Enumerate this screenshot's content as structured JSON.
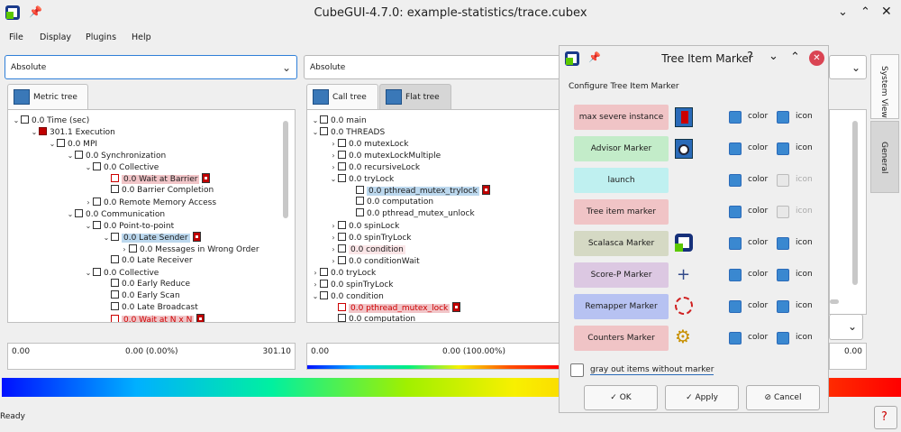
{
  "window": {
    "title": "CubeGUI-4.7.0: example-statistics/trace.cubex"
  },
  "menu": [
    "File",
    "Display",
    "Plugins",
    "Help"
  ],
  "metric": {
    "combo": "Absolute",
    "tab": "Metric tree",
    "scale_left": "0.00",
    "scale_mid": "0.00 (0.00%)",
    "scale_right": "301.10",
    "nodes": [
      "0.0 Time (sec)",
      "301.1 Execution",
      "0.0 MPI",
      "0.0 Synchronization",
      "0.0 Collective",
      "0.0 Wait at Barrier",
      "0.0 Barrier Completion",
      "0.0 Remote Memory Access",
      "0.0 Communication",
      "0.0 Point-to-point",
      "0.0 Late Sender",
      "0.0 Messages in Wrong Order",
      "0.0 Late Receiver",
      "0.0 Collective",
      "0.0 Early Reduce",
      "0.0 Early Scan",
      "0.0 Late Broadcast",
      "0.0 Wait at N x N"
    ]
  },
  "call": {
    "combo": "Absolute",
    "tab_call": "Call tree",
    "tab_flat": "Flat tree",
    "scale_left": "0.00",
    "scale_mid": "0.00 (100.00%)",
    "nodes": [
      "0.0 main",
      "0.0 THREADS",
      "0.0 mutexLock",
      "0.0 mutexLockMultiple",
      "0.0 recursiveLock",
      "0.0 tryLock",
      "0.0 pthread_mutex_trylock",
      "0.0 computation",
      "0.0 pthread_mutex_unlock",
      "0.0 spinLock",
      "0.0 spinTryLock",
      "0.0 condition",
      "0.0 conditionWait",
      "0.0 tryLock",
      "0.0 spinTryLock",
      "0.0 condition",
      "0.0 pthread_mutex_lock",
      "0.0 computation"
    ]
  },
  "system": {
    "scale_right": "0.00",
    "tab_system": "System View",
    "tab_general": "General"
  },
  "dialog": {
    "title": "Tree Item Marker",
    "heading": "Configure Tree Item Marker",
    "color_label": "color",
    "icon_label": "icon",
    "markers": [
      {
        "label": "max severe instance",
        "bg": "#f0c4c6",
        "icon": "red-marker-icon",
        "color": true,
        "icon_on": true
      },
      {
        "label": "Advisor Marker",
        "bg": "#c3ecc9",
        "icon": "advisor-eye-icon",
        "color": true,
        "icon_on": true
      },
      {
        "label": "launch",
        "bg": "#bff0f0",
        "icon": "",
        "color": true,
        "icon_on": false
      },
      {
        "label": "Tree item marker",
        "bg": "#f0c4c6",
        "icon": "",
        "color": true,
        "icon_on": false
      },
      {
        "label": "Scalasca Marker",
        "bg": "#d5d9c4",
        "icon": "scalasca-logo-icon",
        "color": true,
        "icon_on": true
      },
      {
        "label": "Score-P Marker",
        "bg": "#dcc8e2",
        "icon": "scorep-plus-icon",
        "color": true,
        "icon_on": true
      },
      {
        "label": "Remapper Marker",
        "bg": "#b7c2f2",
        "icon": "remapper-cycle-icon",
        "color": true,
        "icon_on": true
      },
      {
        "label": "Counters Marker",
        "bg": "#f0c4c6",
        "icon": "gear-icon",
        "color": true,
        "icon_on": true
      }
    ],
    "grayout_label": "gray out items without marker",
    "ok": "OK",
    "apply": "Apply",
    "cancel": "Cancel"
  },
  "status": "Ready"
}
